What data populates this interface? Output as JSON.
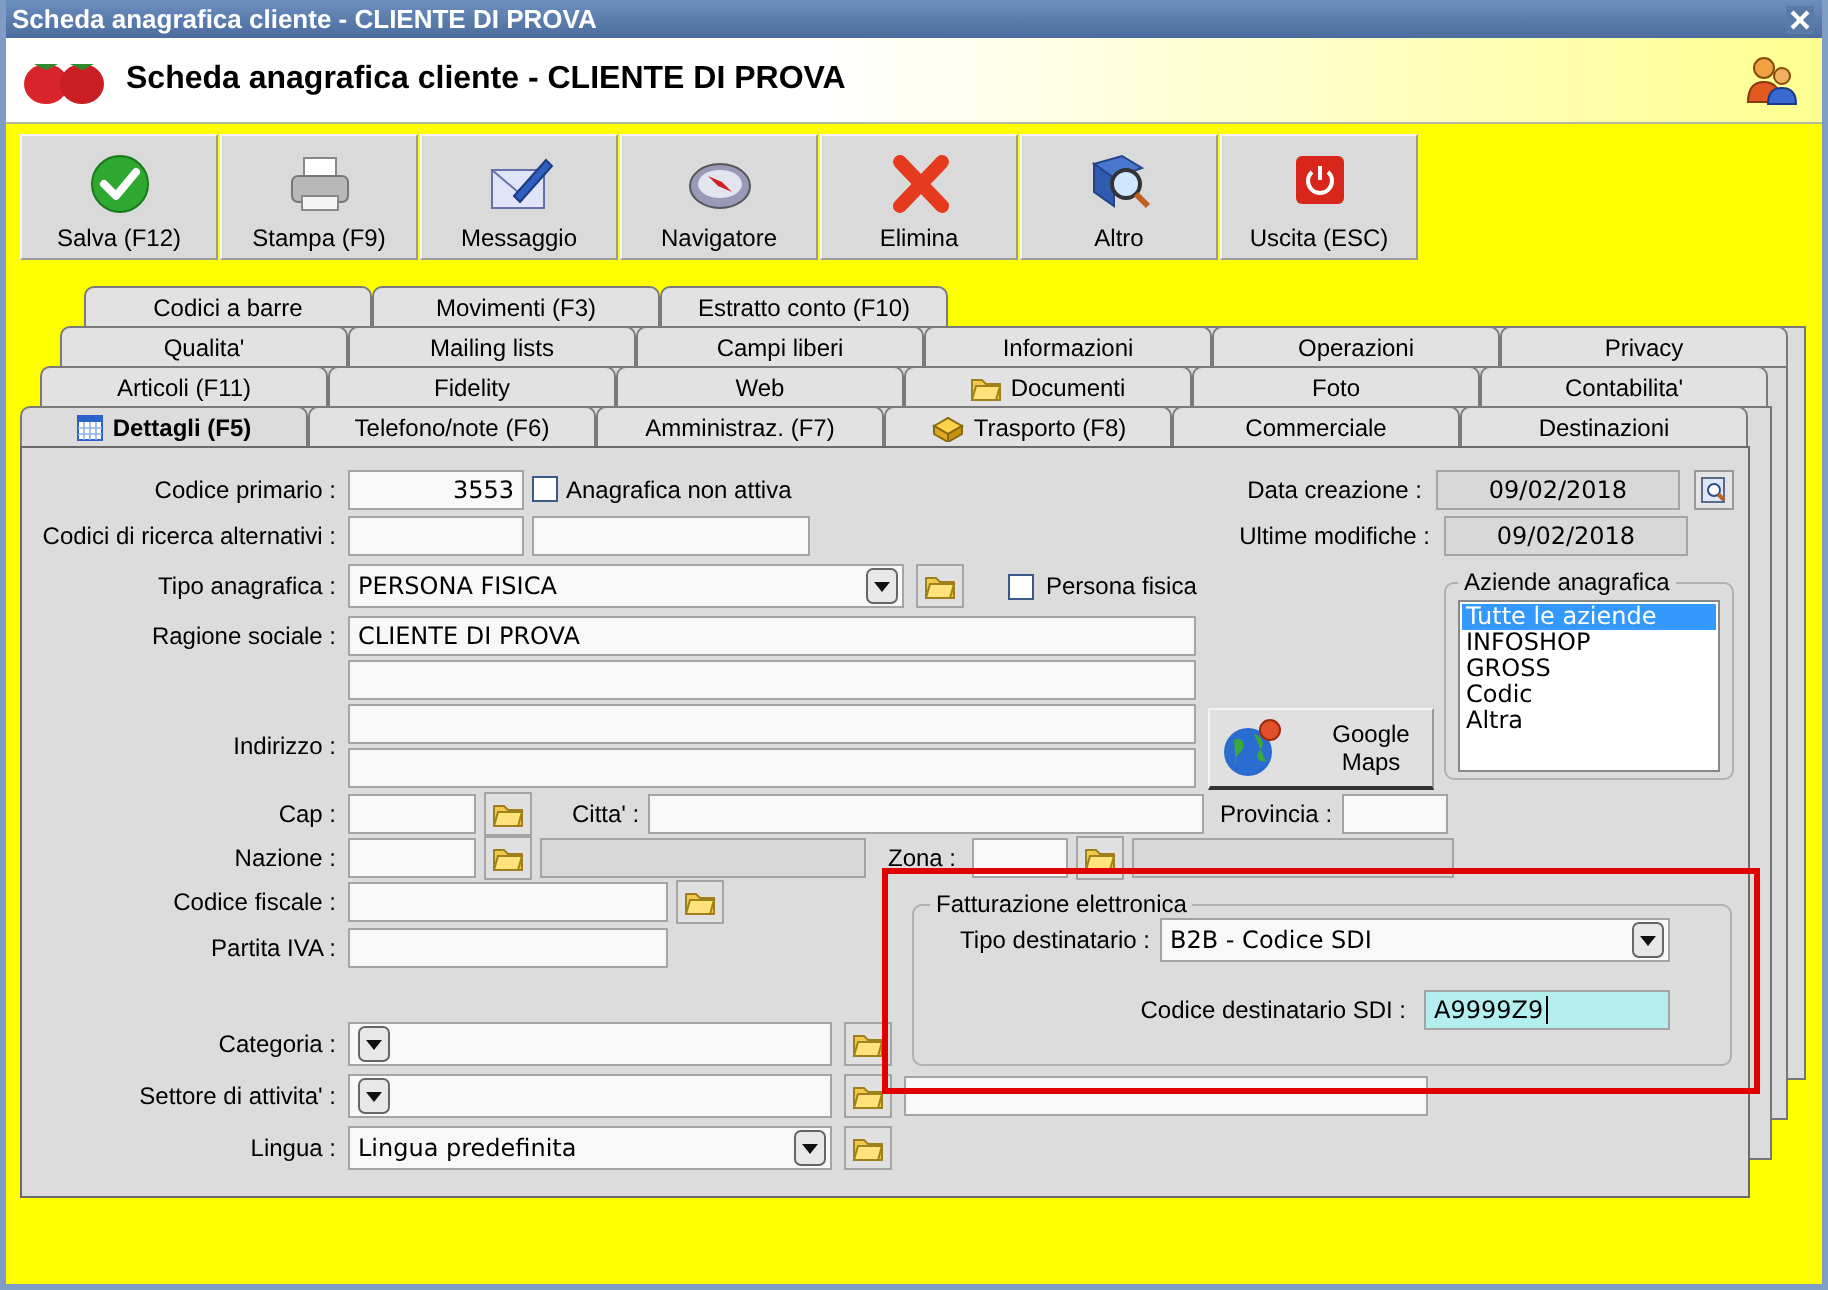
{
  "window": {
    "title": "Scheda anagrafica cliente - CLIENTE DI PROVA"
  },
  "header": {
    "title": "Scheda anagrafica cliente - CLIENTE DI PROVA"
  },
  "toolbar": [
    {
      "label": "Salva (F12)"
    },
    {
      "label": "Stampa (F9)"
    },
    {
      "label": "Messaggio"
    },
    {
      "label": "Navigatore"
    },
    {
      "label": "Elimina"
    },
    {
      "label": "Altro"
    },
    {
      "label": "Uscita (ESC)"
    }
  ],
  "tab_rows": [
    {
      "tabs": [
        {
          "label": "Codici a barre",
          "selected": false
        },
        {
          "label": "Movimenti (F3)",
          "selected": false
        },
        {
          "label": "Estratto conto (F10)",
          "selected": false
        }
      ]
    },
    {
      "tabs": [
        {
          "label": "Qualita'",
          "selected": false
        },
        {
          "label": "Mailing lists",
          "selected": false
        },
        {
          "label": "Campi liberi",
          "selected": false
        },
        {
          "label": "Informazioni",
          "selected": false
        },
        {
          "label": "Operazioni",
          "selected": false
        },
        {
          "label": "Privacy",
          "selected": false
        }
      ]
    },
    {
      "tabs": [
        {
          "label": "Articoli (F11)",
          "selected": false
        },
        {
          "label": "Fidelity",
          "selected": false
        },
        {
          "label": "Web",
          "selected": false
        },
        {
          "label": "Documenti",
          "selected": false
        },
        {
          "label": "Foto",
          "selected": false
        },
        {
          "label": "Contabilita'",
          "selected": false
        }
      ]
    },
    {
      "tabs": [
        {
          "label": "Dettagli (F5)",
          "selected": true
        },
        {
          "label": "Telefono/note (F6)",
          "selected": false
        },
        {
          "label": "Amministraz. (F7)",
          "selected": false
        },
        {
          "label": "Trasporto (F8)",
          "selected": false
        },
        {
          "label": "Commerciale",
          "selected": false
        },
        {
          "label": "Destinazioni",
          "selected": false
        }
      ]
    }
  ],
  "details": {
    "codice_primario": {
      "label": "Codice primario :",
      "value": "3553"
    },
    "anagrafica_non_attiva": {
      "label": "Anagrafica non attiva",
      "checked": false
    },
    "codici_ricerca": {
      "label": "Codici di ricerca alternativi :"
    },
    "data_creazione": {
      "label": "Data creazione :",
      "value": "09/02/2018"
    },
    "ultime_modifiche": {
      "label": "Ultime modifiche :",
      "value": "09/02/2018"
    },
    "tipo_anagrafica": {
      "label": "Tipo anagrafica :",
      "value": "PERSONA FISICA"
    },
    "persona_fisica": {
      "label": "Persona fisica",
      "checked": false
    },
    "ragione_sociale": {
      "label": "Ragione sociale :",
      "value": "CLIENTE DI PROVA"
    },
    "indirizzo": {
      "label": "Indirizzo :"
    },
    "google_maps": {
      "label": "Google Maps"
    },
    "cap": {
      "label": "Cap :"
    },
    "citta": {
      "label": "Citta' :"
    },
    "provincia": {
      "label": "Provincia :"
    },
    "nazione": {
      "label": "Nazione :"
    },
    "zona": {
      "label": "Zona :"
    },
    "codice_fiscale": {
      "label": "Codice fiscale :"
    },
    "partita_iva": {
      "label": "Partita IVA :"
    },
    "categoria": {
      "label": "Categoria :"
    },
    "settore": {
      "label": "Settore di attivita' :"
    },
    "lingua": {
      "label": "Lingua :",
      "value": "Lingua predefinita"
    },
    "aziende": {
      "title": "Aziende anagrafica",
      "items": [
        {
          "label": "Tutte le aziende",
          "selected": true
        },
        {
          "label": "INFOSHOP",
          "selected": false
        },
        {
          "label": "GROSS",
          "selected": false
        },
        {
          "label": "Codic",
          "selected": false
        },
        {
          "label": "Altra",
          "selected": false
        }
      ]
    },
    "fatturazione": {
      "title": "Fatturazione elettronica",
      "tipo_destinatario": {
        "label": "Tipo destinatario :",
        "value": "B2B - Codice SDI"
      },
      "codice_sdi": {
        "label": "Codice destinatario SDI :",
        "value": "A9999Z9",
        "focused": true
      }
    }
  }
}
